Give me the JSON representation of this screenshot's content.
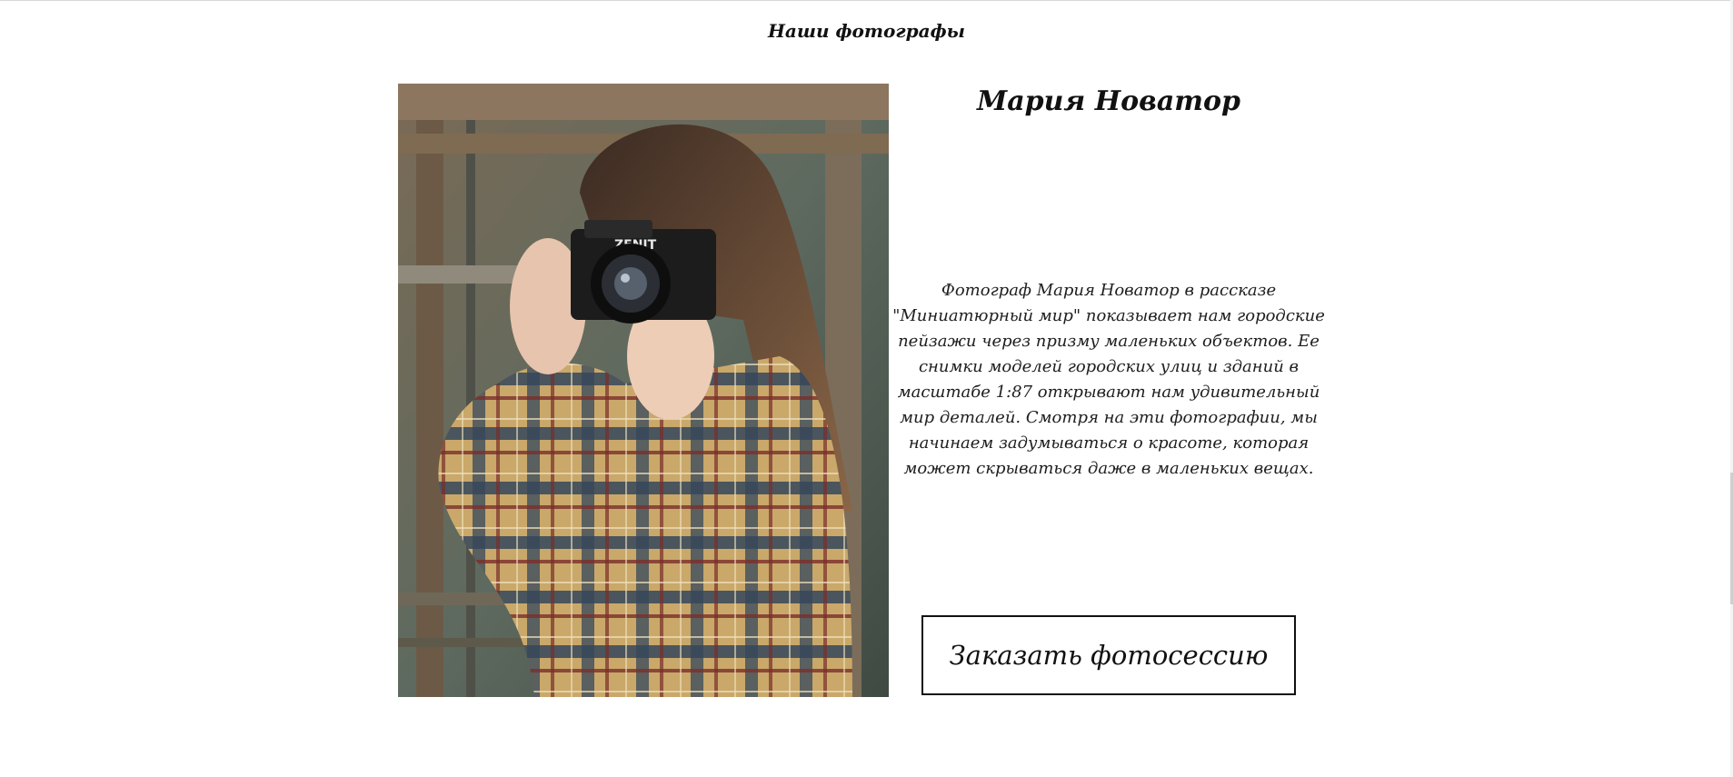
{
  "section": {
    "title": "Наши фотографы"
  },
  "photographer": {
    "name": "Мария Новатор",
    "photo": {
      "alt": "photographer-portrait",
      "camera_brand": "ZENIT"
    },
    "description": "Фотограф Мария Новатор в рассказе \"Миниатюрный мир\" показывает нам городские пейзажи через призму маленьких объектов. Ее снимки моделей городских улиц и зданий в масштабе 1:87 открывают нам удивительный мир деталей. Смотря на эти фотографии, мы начинаем задумываться о красоте, которая может скрываться даже в маленьких вещах.",
    "order_button_label": "Заказать фотосессию"
  },
  "colors": {
    "background": "#ffffff",
    "text": "#111111",
    "button_border": "#111111"
  }
}
